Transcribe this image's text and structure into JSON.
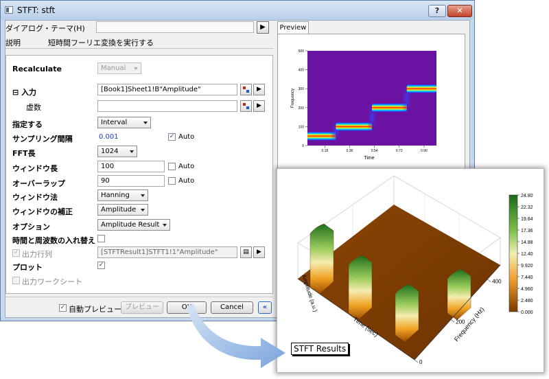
{
  "window": {
    "title": "STFT: stft",
    "help_label": "?",
    "close_label": "✕"
  },
  "theme": {
    "label": "ダイアログ・テーマ(H)",
    "value": "",
    "arrow": "▶"
  },
  "description": {
    "label": "説明",
    "text": "短時間フーリエ変換を実行する"
  },
  "params": {
    "recalculate": {
      "label": "Recalculate",
      "value": "Manual"
    },
    "input": {
      "label": "入力",
      "tree": "⊟",
      "value": "[Book1]Sheet1!B\"Amplitude\""
    },
    "imag": {
      "label": "虚数",
      "value": ""
    },
    "specify": {
      "label": "指定する",
      "value": "Interval"
    },
    "sampling": {
      "label": "サンプリング間隔",
      "value": "0.001",
      "auto_label": "Auto",
      "auto_checked": "✓"
    },
    "fft": {
      "label": "FFT長",
      "value": "1024"
    },
    "window_len": {
      "label": "ウィンドウ長",
      "value": "100",
      "auto_label": "Auto"
    },
    "overlap": {
      "label": "オーバーラップ",
      "value": "90",
      "auto_label": "Auto"
    },
    "window_method": {
      "label": "ウィンドウ法",
      "value": "Hanning"
    },
    "window_corr": {
      "label": "ウィンドウの補正",
      "value": "Amplitude"
    },
    "option": {
      "label": "オプション",
      "value": "Amplitude Result"
    },
    "swap": {
      "label": "時間と周波数の入れ替え"
    },
    "output": {
      "label": "出力行列",
      "value": "[STFTResult1]STFT1!1\"Amplitude\"",
      "checked": "✓"
    },
    "plot": {
      "label": "プロット",
      "checked": "✓"
    },
    "worksheet": {
      "label": "出力ワークシート"
    }
  },
  "footer": {
    "auto_preview": "自動プレビュー",
    "auto_preview_checked": "✓",
    "preview_btn": "プレビュー",
    "ok_btn": "OK",
    "cancel_btn": "Cancel",
    "collapse_btn": "«"
  },
  "preview": {
    "tab": "Preview",
    "xlabel": "Time",
    "ylabel": "Frequency",
    "yticks": [
      "0",
      "100",
      "200",
      "300",
      "400",
      "500"
    ],
    "xticks": [
      "0.18",
      "0.36",
      "0.54",
      "0.72",
      "0.90"
    ],
    "segments": [
      {
        "t0": 0.0,
        "t1": 0.22,
        "f": 50
      },
      {
        "t0": 0.22,
        "t1": 0.5,
        "f": 100
      },
      {
        "t0": 0.5,
        "t1": 0.77,
        "f": 200
      },
      {
        "t0": 0.77,
        "t1": 1.0,
        "f": 300
      }
    ]
  },
  "result": {
    "title": "STFT Results",
    "zlabel": "Amplitude (a.u.)",
    "xlabel": "Time (sec)",
    "ylabel": "Frequency (Hz)",
    "freq_ticks": [
      "0",
      "200",
      "400"
    ],
    "colorbar_ticks": [
      "24.80",
      "22.32",
      "19.84",
      "17.36",
      "14.88",
      "12.40",
      "9.920",
      "7.440",
      "4.960",
      "2.480",
      "0.000"
    ],
    "colors": {
      "high": "#1b6a1b",
      "mid": "#e8e080",
      "low": "#7a3a00"
    }
  }
}
